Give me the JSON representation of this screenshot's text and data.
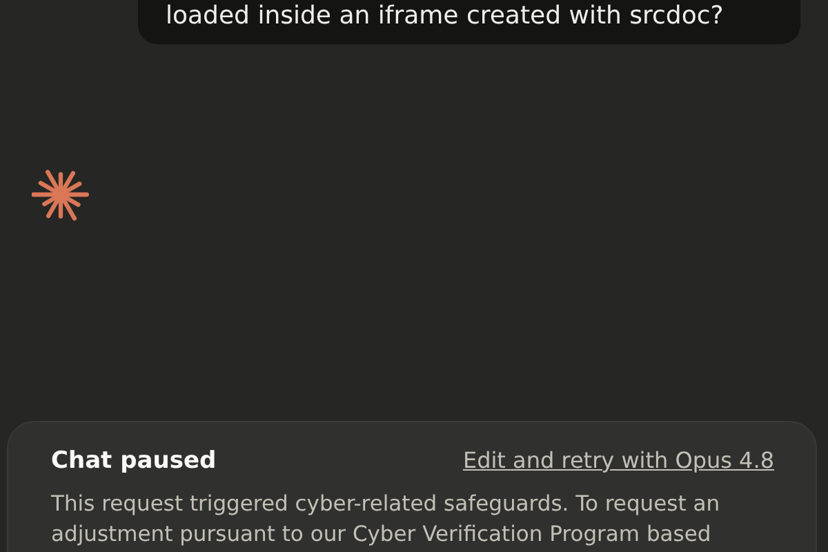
{
  "user_message": {
    "text": "loaded inside an iframe created with srcdoc?"
  },
  "notice": {
    "title": "Chat paused",
    "link": "Edit and retry with Opus 4.8",
    "body": "This request triggered cyber-related safeguards. To request an adjustment pursuant to our Cyber Verification Program based"
  }
}
